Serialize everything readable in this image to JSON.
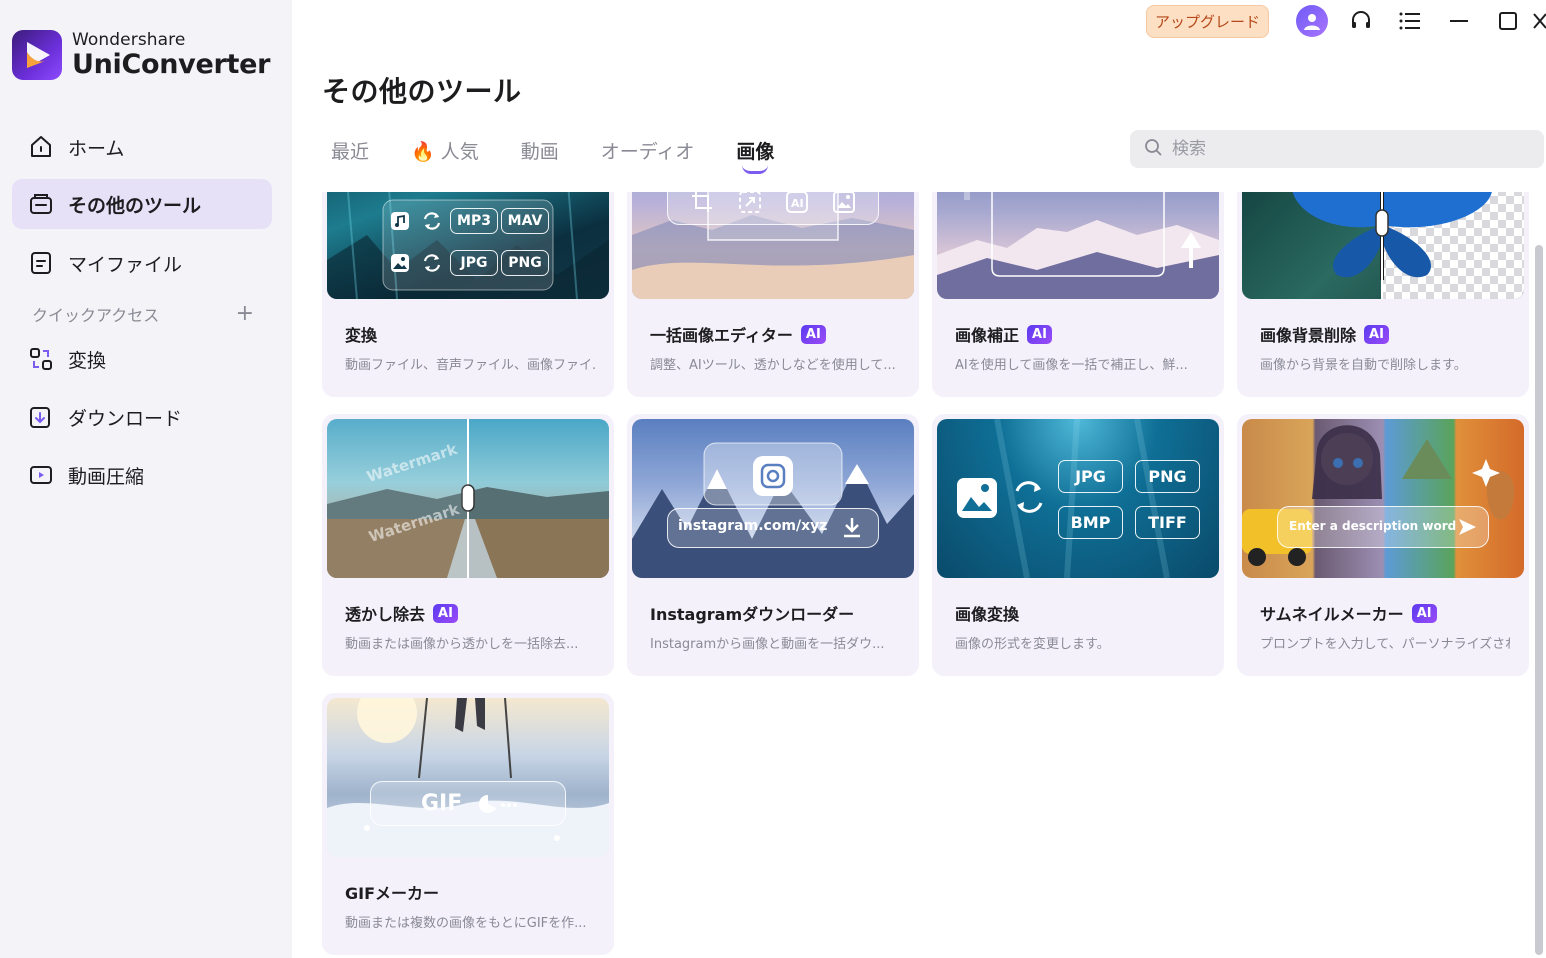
{
  "app": {
    "brand_sub": "Wondershare",
    "brand_main": "UniConverter"
  },
  "titlebar": {
    "upgrade_label": "アップグレード"
  },
  "sidebar": {
    "items": [
      {
        "label": "ホーム"
      },
      {
        "label": "その他のツール"
      },
      {
        "label": "マイファイル"
      }
    ],
    "quick_access_label": "クイックアクセス",
    "quick_items": [
      {
        "label": "変換"
      },
      {
        "label": "ダウンロード"
      },
      {
        "label": "動画圧縮"
      }
    ]
  },
  "main": {
    "title": "その他のツール",
    "tabs": [
      {
        "label": "最近"
      },
      {
        "label": "人気"
      },
      {
        "label": "動画"
      },
      {
        "label": "オーディオ"
      },
      {
        "label": "画像"
      }
    ],
    "active_tab": "画像",
    "search_placeholder": "検索"
  },
  "ai_badge": "AI",
  "cards": [
    {
      "title": "変換",
      "desc": "動画ファイル、音声ファイル、画像ファイ...",
      "ai": false,
      "thumb_text": [
        "MP3",
        "MAV",
        "JPG",
        "PNG"
      ]
    },
    {
      "title": "一括画像エディター",
      "desc": "調整、AIツール、透かしなどを使用して...",
      "ai": true
    },
    {
      "title": "画像補正",
      "desc": "AIを使用して画像を一括で補正し、鮮...",
      "ai": true
    },
    {
      "title": "画像背景削除",
      "desc": "画像から背景を自動で削除します。",
      "ai": true
    },
    {
      "title": "透かし除去",
      "desc": "動画または画像から透かしを一括除去...",
      "ai": true,
      "thumb_text": [
        "Watermark"
      ]
    },
    {
      "title": "Instagramダウンローダー",
      "desc": "Instagramから画像と動画を一括ダウ...",
      "ai": false,
      "thumb_text": [
        "instagram.com/xyz"
      ]
    },
    {
      "title": "画像変換",
      "desc": "画像の形式を変更します。",
      "ai": false,
      "thumb_text": [
        "JPG",
        "PNG",
        "BMP",
        "TIFF"
      ]
    },
    {
      "title": "サムネイルメーカー",
      "desc": "プロンプトを入力して、パーソナライズされ...",
      "ai": true,
      "thumb_text": [
        "Enter a description word"
      ]
    },
    {
      "title": "GIFメーカー",
      "desc": "動画または複数の画像をもとにGIFを作...",
      "ai": false,
      "thumb_text": [
        "GIF"
      ]
    }
  ],
  "colors": {
    "accent": "#7b5bf0",
    "active_bg": "#e7e1f8",
    "card_bg": "#f4f1fb",
    "upgrade_bg": "#fde0c4"
  }
}
